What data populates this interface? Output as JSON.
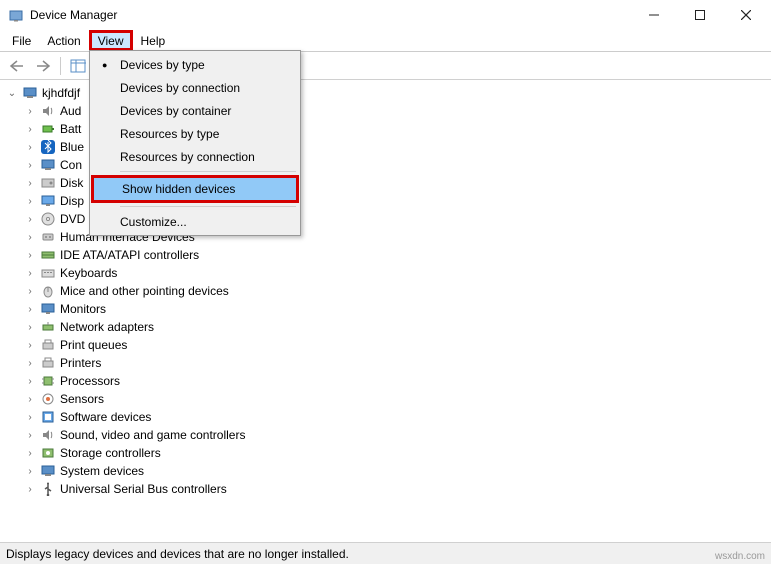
{
  "window": {
    "title": "Device Manager"
  },
  "menubar": {
    "file": "File",
    "action": "Action",
    "view": "View",
    "help": "Help"
  },
  "popup": {
    "devices_by_type": "Devices by type",
    "devices_by_connection": "Devices by connection",
    "devices_by_container": "Devices by container",
    "resources_by_type": "Resources by type",
    "resources_by_connection": "Resources by connection",
    "show_hidden_devices": "Show hidden devices",
    "customize": "Customize..."
  },
  "tree": {
    "root": "kjhdfdjf",
    "items": [
      {
        "icon": "audio",
        "label": "Aud"
      },
      {
        "icon": "battery",
        "label": "Batt"
      },
      {
        "icon": "bluetooth",
        "label": "Blue"
      },
      {
        "icon": "computer",
        "label": "Con"
      },
      {
        "icon": "disk",
        "label": "Disk"
      },
      {
        "icon": "display",
        "label": "Disp"
      },
      {
        "icon": "dvd",
        "label": "DVD"
      },
      {
        "icon": "hid",
        "label": "Human Interface Devices"
      },
      {
        "icon": "ide",
        "label": "IDE ATA/ATAPI controllers"
      },
      {
        "icon": "keyboard",
        "label": "Keyboards"
      },
      {
        "icon": "mouse",
        "label": "Mice and other pointing devices"
      },
      {
        "icon": "monitor",
        "label": "Monitors"
      },
      {
        "icon": "network",
        "label": "Network adapters"
      },
      {
        "icon": "printq",
        "label": "Print queues"
      },
      {
        "icon": "printer",
        "label": "Printers"
      },
      {
        "icon": "cpu",
        "label": "Processors"
      },
      {
        "icon": "sensor",
        "label": "Sensors"
      },
      {
        "icon": "software",
        "label": "Software devices"
      },
      {
        "icon": "sound",
        "label": "Sound, video and game controllers"
      },
      {
        "icon": "storage",
        "label": "Storage controllers"
      },
      {
        "icon": "system",
        "label": "System devices"
      },
      {
        "icon": "usb",
        "label": "Universal Serial Bus controllers"
      }
    ]
  },
  "status": {
    "text": "Displays legacy devices and devices that are no longer installed."
  },
  "watermark": "wsxdn.com"
}
